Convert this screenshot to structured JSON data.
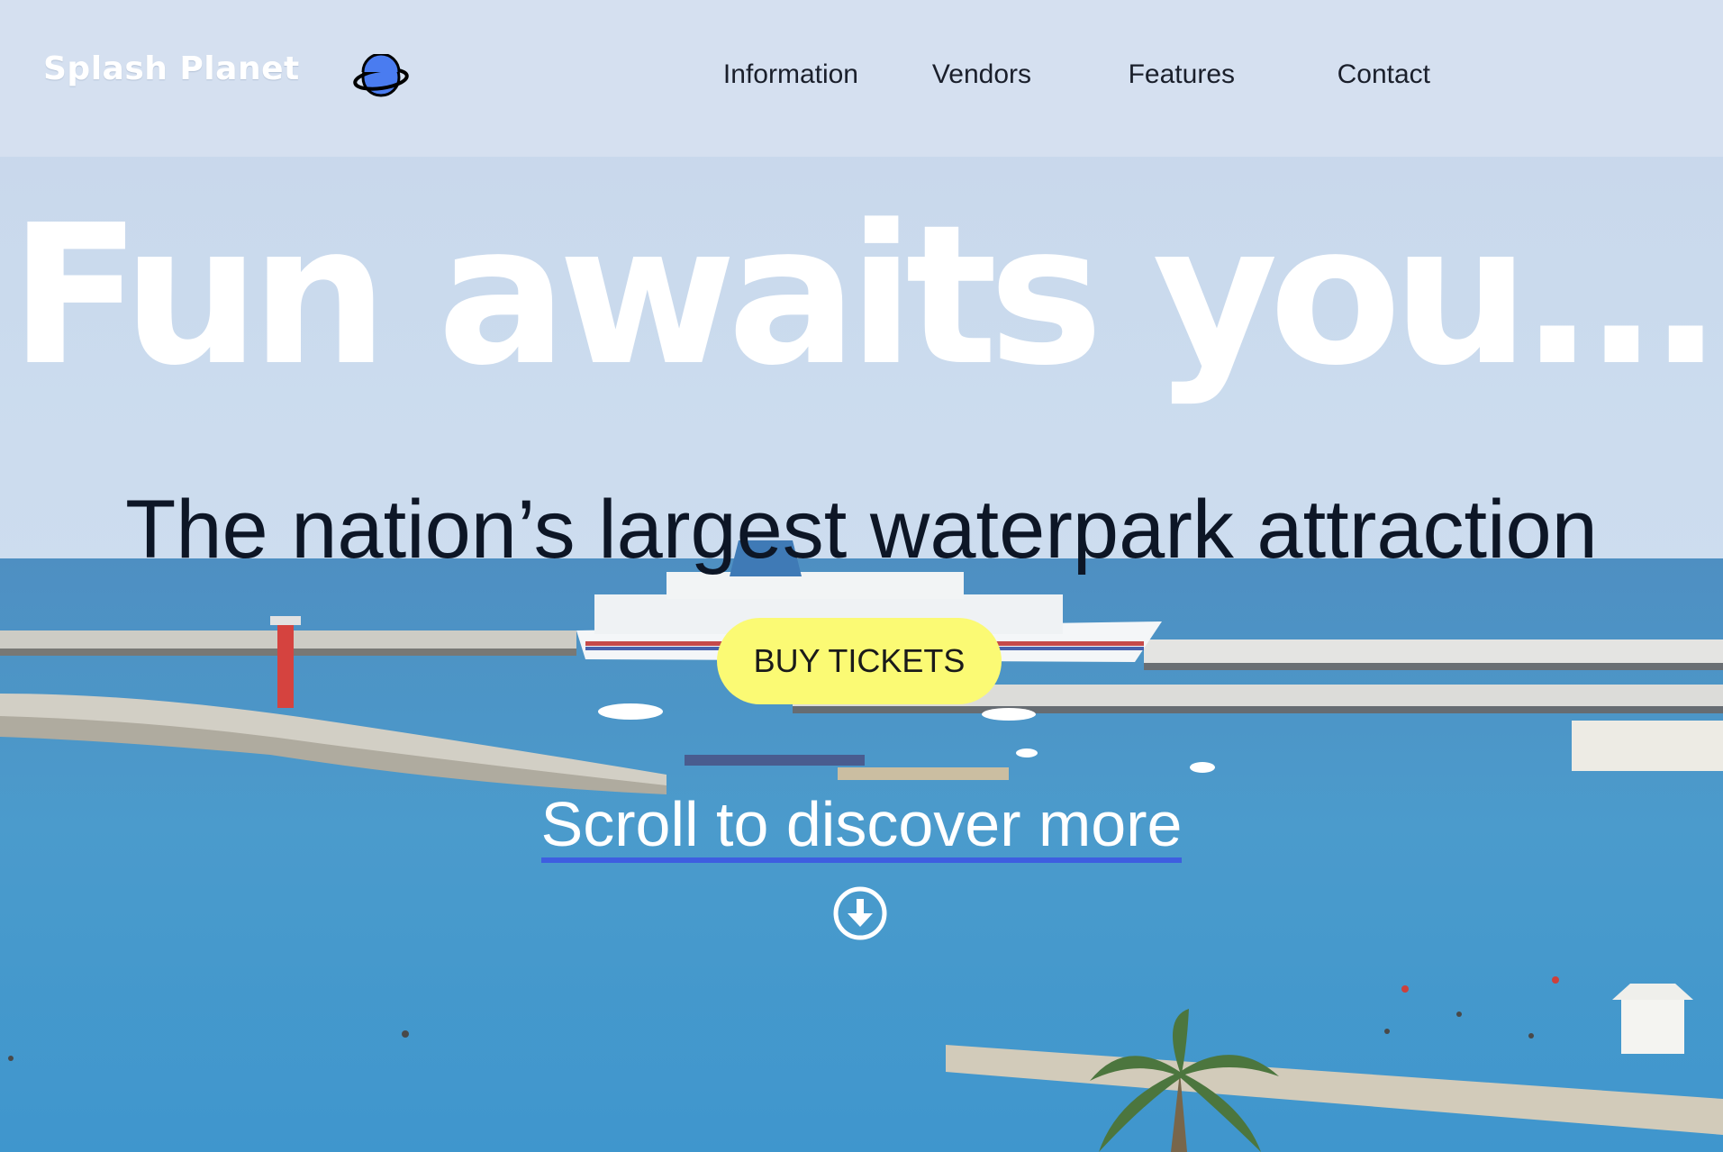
{
  "header": {
    "logo_text": "Splash Planet",
    "logo_icon": "planet-icon",
    "nav": [
      {
        "label": "Information"
      },
      {
        "label": "Vendors"
      },
      {
        "label": "Features"
      },
      {
        "label": "Contact"
      }
    ]
  },
  "hero": {
    "title": "Fun awaits you...",
    "subtitle": "The nation’s largest waterpark attraction",
    "cta_label": "BUY TICKETS",
    "scroll_label": "Scroll to discover more",
    "scroll_icon": "arrow-down-circle-icon"
  },
  "colors": {
    "cta_background": "#fbfa74",
    "link_underline": "#3e5ee0",
    "planet_fill": "#4a7cf0",
    "header_background": "#d8e2f0"
  }
}
